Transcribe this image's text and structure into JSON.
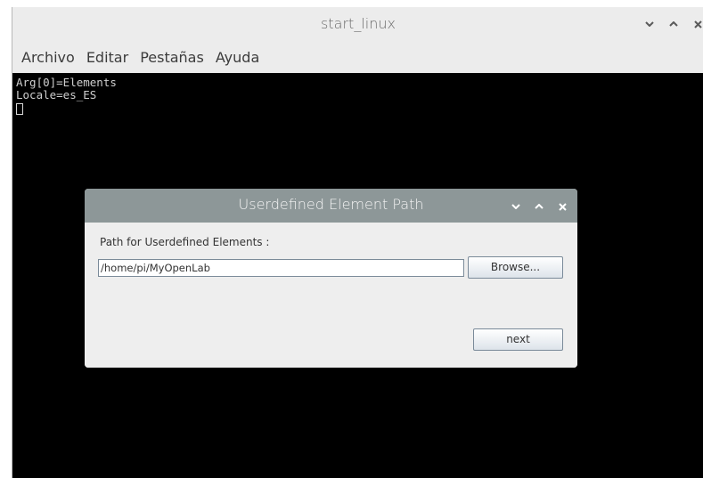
{
  "window": {
    "title": "start_linux",
    "controls": [
      "minimize-icon",
      "maximize-icon",
      "close-icon"
    ]
  },
  "menubar": {
    "items": [
      {
        "label": "Archivo"
      },
      {
        "label": "Editar"
      },
      {
        "label": "Pestañas"
      },
      {
        "label": "Ayuda"
      }
    ]
  },
  "terminal": {
    "lines": [
      "Arg[0]=Elements",
      "Locale=es_ES"
    ]
  },
  "dialog": {
    "title": "Userdefined Element Path",
    "path_label": "Path for Userdefined Elements :",
    "path_value": "/home/pi/MyOpenLab",
    "browse_label": "Browse...",
    "next_label": "next"
  },
  "colors": {
    "terminal_bg": "#000000",
    "dialog_titlebar": "#8d9798",
    "window_chrome": "#ececec"
  }
}
